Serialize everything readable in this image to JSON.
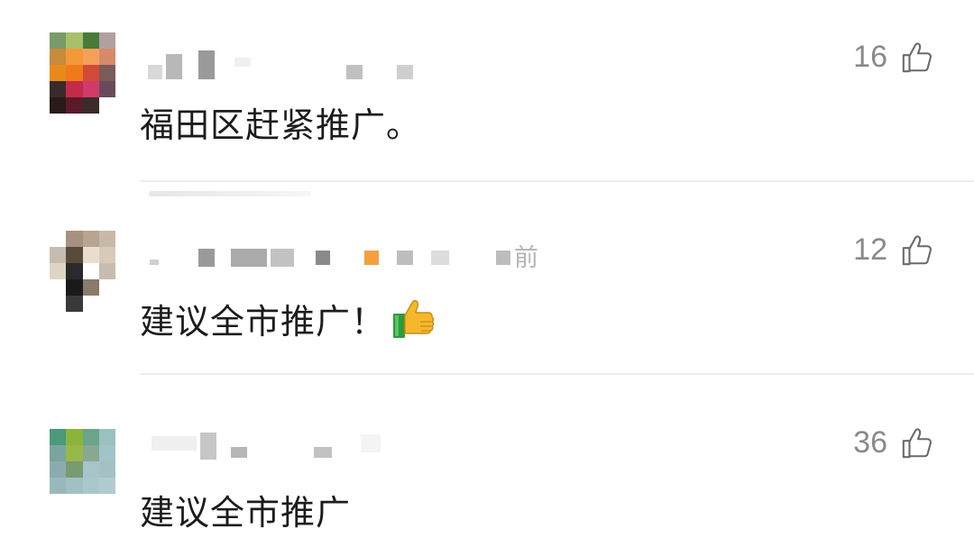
{
  "comments": [
    {
      "avatar_colors": [
        "#7a9a6a",
        "#a8c06a",
        "#4a7a3a",
        "#b2a0a0",
        "#c98a3a",
        "#f4983a",
        "#f4a05a",
        "#d68a6a",
        "#e88a1a",
        "#f07a1a",
        "#d24a3a",
        "#7a5a5a",
        "#3a2a2a",
        "#c42a4a",
        "#d23a6a",
        "#6a4a5a",
        "#2a1a1a",
        "#5a1a2a",
        "#3a2a2a",
        "#ffffff"
      ],
      "time_suffix": "",
      "text": "福田区赶紧推广。",
      "likes": "16",
      "emoji": ""
    },
    {
      "avatar_colors": [
        "#ffffff",
        "#a89080",
        "#b8a490",
        "#c8b8a8",
        "#c8bcb0",
        "#5a4a3a",
        "#e8ded0",
        "#d8cab8",
        "#e0d4c4",
        "#2a2a2a",
        "#ffffff",
        "#c8bcb0",
        "#ffffff",
        "#1a1a1a",
        "#8a7a6a",
        "#ffffff",
        "#ffffff",
        "#3a3a3a",
        "#ffffff",
        "#ffffff"
      ],
      "time_suffix": "前",
      "text": "建议全市推广！",
      "likes": "12",
      "emoji": "thumbs-up"
    },
    {
      "avatar_colors": [
        "#4a9a7a",
        "#8ab43a",
        "#6aa48a",
        "#9ac0c0",
        "#7aa4a0",
        "#98b84a",
        "#8aa890",
        "#a0c4c8",
        "#8aacb0",
        "#7a9a70",
        "#a8c4c8",
        "#a4c0c4",
        "#9ab8bc",
        "#a0c0c4",
        "#a8c8cc",
        "#b0ccd0",
        "#ffffff",
        "#ffffff",
        "#ffffff",
        "#ffffff"
      ],
      "time_suffix": "",
      "text": "建议全市推广",
      "likes": "36",
      "emoji": ""
    }
  ],
  "colors": {
    "text": "#1c1c1c",
    "meta": "#8a8a8a",
    "divider": "#eeeeee"
  }
}
